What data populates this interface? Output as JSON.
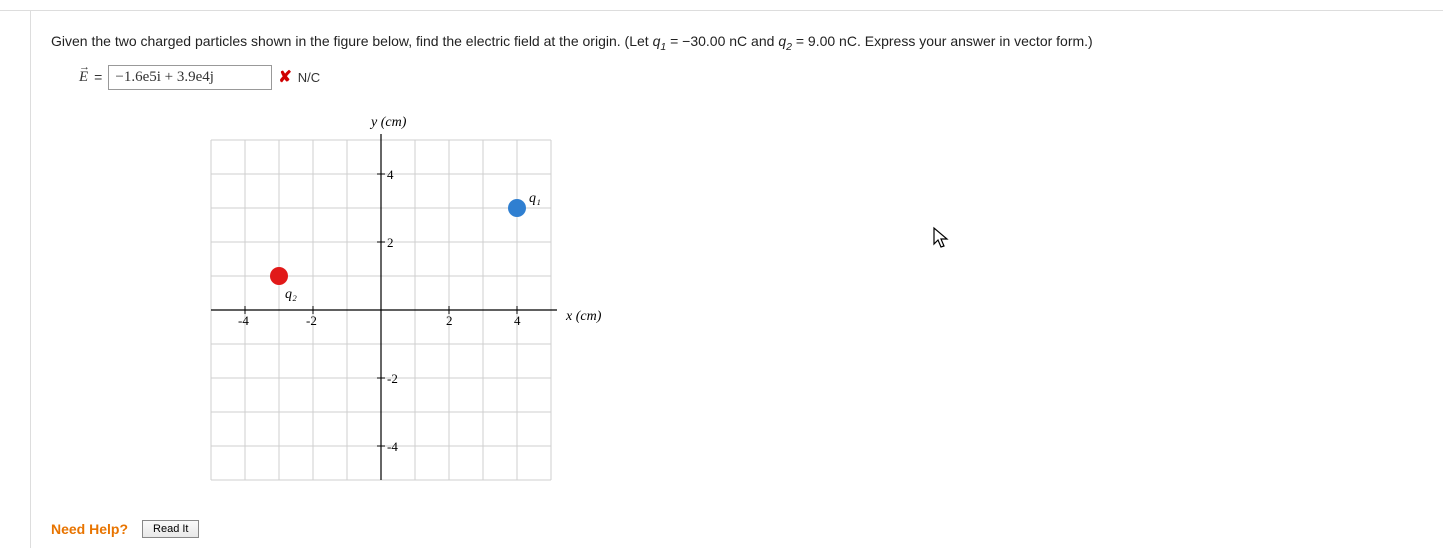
{
  "problem": {
    "intro": "Given the two charged particles shown in the figure below, find the electric field at the origin. (Let ",
    "q1_sym": "q",
    "q1_sub": "1",
    "eq1": " = ",
    "q1_val": "−30.00 nC",
    "and": "  and  ",
    "q2_sym": "q",
    "q2_sub": "2",
    "eq2": " = ",
    "q2_val": "9.00 nC.",
    "outro": "  Express your answer in vector form.)"
  },
  "answer": {
    "lhs": "E",
    "equals": " = ",
    "value": "−1.6e5i + 3.9e4j",
    "units": "N/C"
  },
  "chart_data": {
    "type": "scatter",
    "xlabel": "x (cm)",
    "ylabel": "y (cm)",
    "xlim": [
      -5,
      5
    ],
    "ylim": [
      -5,
      5
    ],
    "xticks": [
      -4,
      -2,
      2,
      4
    ],
    "yticks": [
      -4,
      -2,
      2,
      4
    ],
    "points": [
      {
        "name": "q1",
        "label": "q₁",
        "x": 4,
        "y": 3,
        "color": "#2f7fd1"
      },
      {
        "name": "q2",
        "label": "q₂",
        "x": -3,
        "y": 1,
        "color": "#e11919"
      }
    ]
  },
  "help": {
    "label": "Need Help?",
    "read": "Read It"
  }
}
